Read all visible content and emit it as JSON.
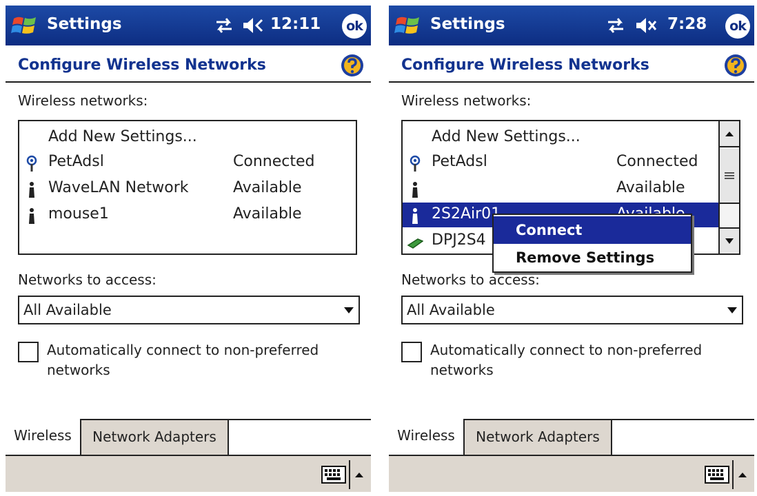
{
  "screens": {
    "left": {
      "app_title": "Settings",
      "time": "12:11",
      "ok_label": "ok",
      "page_title": "Configure Wireless Networks",
      "networks_label": "Wireless networks:",
      "add_new": "Add New Settings...",
      "networks": [
        {
          "name": "PetAdsl",
          "status": "Connected",
          "icon": "antenna-icon"
        },
        {
          "name": "WaveLAN Network",
          "status": "Available",
          "icon": "access-point-icon"
        },
        {
          "name": "mouse1",
          "status": "Available",
          "icon": "access-point-icon"
        }
      ],
      "access_label": "Networks to access:",
      "access_value": "All Available",
      "checkbox_label": "Automatically connect to non-preferred networks",
      "checkbox_checked": false,
      "tabs": [
        "Wireless",
        "Network Adapters"
      ]
    },
    "right": {
      "app_title": "Settings",
      "time": "7:28",
      "ok_label": "ok",
      "page_title": "Configure Wireless Networks",
      "networks_label": "Wireless networks:",
      "add_new": "Add New Settings...",
      "networks": [
        {
          "name": "PetAdsl",
          "status": "Connected",
          "icon": "antenna-icon"
        },
        {
          "name": "",
          "status": "Available",
          "icon": "access-point-icon"
        },
        {
          "name": "2S2Air01",
          "status": "Available",
          "icon": "access-point-icon",
          "selected": true
        },
        {
          "name": "DPJ2S4",
          "status": "",
          "icon": "network-card-icon"
        }
      ],
      "context_menu": [
        "Connect",
        "Remove Settings"
      ],
      "access_label": "Networks to access:",
      "access_value": "All Available",
      "checkbox_label": "Automatically connect to non-preferred networks",
      "checkbox_checked": false,
      "tabs": [
        "Wireless",
        "Network Adapters"
      ]
    }
  },
  "colors": {
    "titlebar": "#1d4aa6",
    "header_text": "#12338f",
    "selection": "#1a2a9a",
    "command_bar": "#ddd7cf"
  }
}
